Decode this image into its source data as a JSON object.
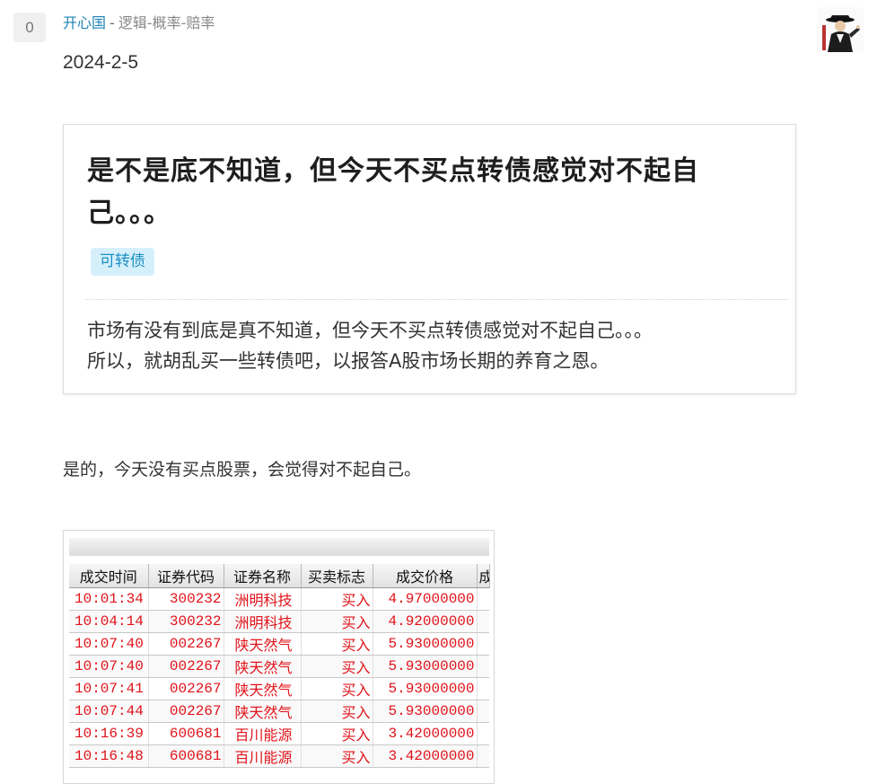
{
  "vote": {
    "count": "0"
  },
  "header": {
    "author": "开心国",
    "separator": "-",
    "category": "逻辑-概率-赔率",
    "date": "2024-2-5"
  },
  "quote": {
    "title": "是不是底不知道，但今天不买点转债感觉对不起自己。。。",
    "tag": "可转债",
    "excerpt_line1": "市场有没有到底是真不知道，但今天不买点转债感觉对不起自己。。。",
    "excerpt_line2": "所以，就胡乱买一些转债吧，以报答A股市场长期的养育之恩。"
  },
  "reply": {
    "text": "是的，今天没有买点股票，会觉得对不起自己。"
  },
  "trade_table": {
    "headers": [
      "成交时间",
      "证券代码",
      "证券名称",
      "买卖标志",
      "成交价格",
      "成"
    ],
    "rows": [
      {
        "time": "10:01:34",
        "code": "300232",
        "name": "洲明科技",
        "side": "买入",
        "price": "4.97000000"
      },
      {
        "time": "10:04:14",
        "code": "300232",
        "name": "洲明科技",
        "side": "买入",
        "price": "4.92000000"
      },
      {
        "time": "10:07:40",
        "code": "002267",
        "name": "陕天然气",
        "side": "买入",
        "price": "5.93000000"
      },
      {
        "time": "10:07:40",
        "code": "002267",
        "name": "陕天然气",
        "side": "买入",
        "price": "5.93000000"
      },
      {
        "time": "10:07:41",
        "code": "002267",
        "name": "陕天然气",
        "side": "买入",
        "price": "5.93000000"
      },
      {
        "time": "10:07:44",
        "code": "002267",
        "name": "陕天然气",
        "side": "买入",
        "price": "5.93000000"
      },
      {
        "time": "10:16:39",
        "code": "600681",
        "name": "百川能源",
        "side": "买入",
        "price": "3.42000000"
      },
      {
        "time": "10:16:48",
        "code": "600681",
        "name": "百川能源",
        "side": "买入",
        "price": "3.42000000"
      }
    ]
  },
  "colors": {
    "link": "#1e82b4",
    "tag_bg": "#d6f0fb",
    "tag_text": "#1a8fc4",
    "trade_text": "#e0131a"
  },
  "icons": {
    "avatar": "avatar-image"
  }
}
